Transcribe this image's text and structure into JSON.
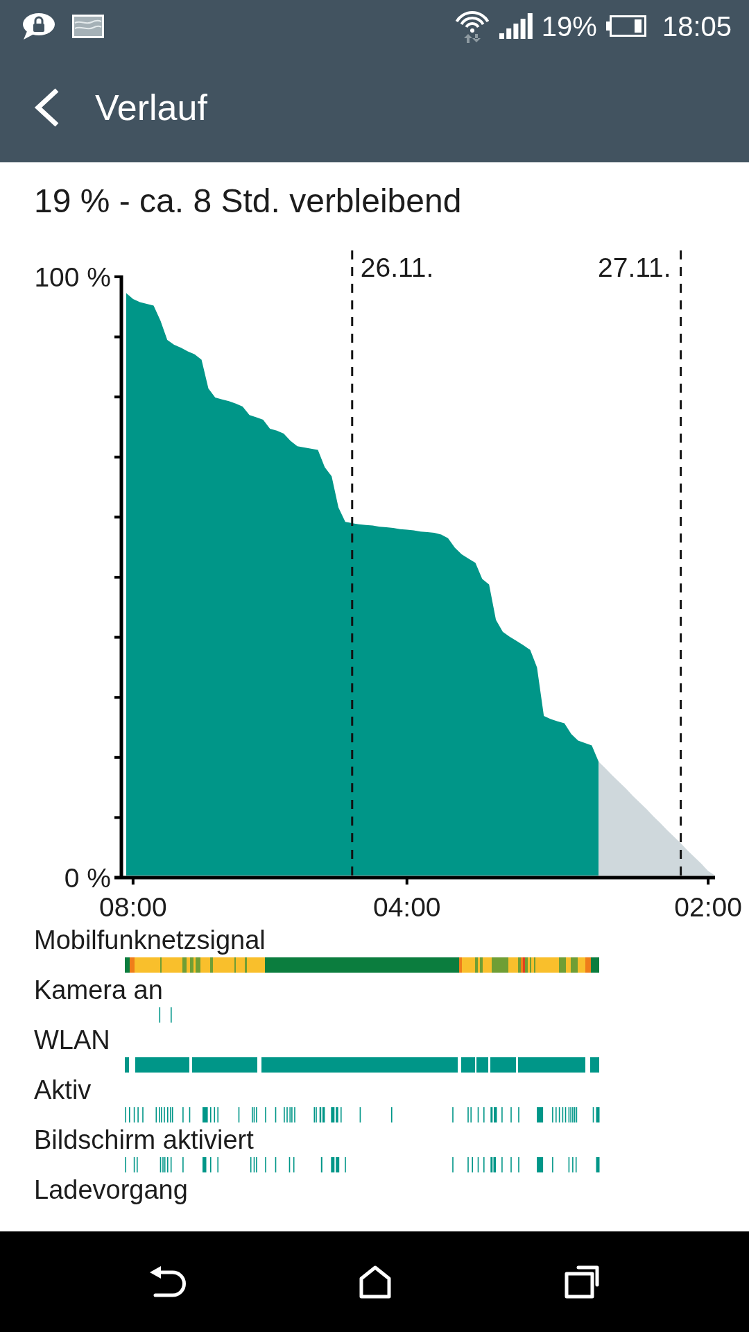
{
  "status_bar": {
    "battery": "19%",
    "time": "18:05"
  },
  "app_bar": {
    "title": "Verlauf"
  },
  "summary": "19 % - ca. 8 Std. verbleibend",
  "chart": {
    "chart_data": {
      "type": "area",
      "categories": [
        null,
        "08:00",
        null,
        null,
        null,
        null,
        null,
        null,
        null,
        null,
        null,
        null,
        null,
        null,
        null,
        null,
        null,
        null,
        null,
        null,
        null,
        null,
        null,
        null,
        null,
        null,
        null,
        null,
        null,
        null,
        null,
        null,
        null,
        null,
        null,
        null,
        null,
        null,
        null,
        null,
        null,
        "04:00",
        null,
        null,
        null,
        null,
        null,
        null,
        null,
        null,
        null,
        null,
        null,
        null,
        null,
        null,
        null,
        null,
        null,
        null,
        null,
        null,
        null,
        null,
        null,
        null,
        null,
        null,
        null,
        null,
        null,
        null,
        null,
        null,
        null,
        null,
        null,
        null,
        null,
        null,
        null,
        null,
        null,
        null,
        null,
        "02:00",
        null
      ],
      "series": [
        {
          "color": "#009688",
          "values": [
            97.3,
            96.3,
            95.8,
            95.5,
            95.2,
            92.7,
            89.5,
            88.7,
            88.2,
            87.6,
            87.1,
            86.2,
            81.4,
            79.9,
            79.6,
            79.3,
            78.9,
            78.4,
            77.0,
            76.6,
            76.2,
            74.7,
            74.4,
            73.9,
            72.7,
            71.8,
            71.6,
            71.4,
            71.2,
            68.3,
            66.8,
            61.6,
            59.2,
            59.0,
            58.8,
            58.7,
            58.6,
            58.4,
            58.3,
            58.2,
            58.0,
            57.9,
            57.8,
            57.6,
            57.5,
            57.4,
            57.1,
            56.5,
            54.9,
            53.8,
            53.1,
            52.4,
            49.7,
            48.8,
            42.9,
            40.9,
            40.1,
            39.4,
            38.7,
            37.9,
            35.0,
            26.9,
            26.4,
            26.0,
            25.7,
            23.9,
            22.8,
            22.4,
            22.0,
            19.3,
            null,
            null,
            null,
            null,
            null,
            null,
            null,
            null,
            null,
            null,
            null,
            null,
            null,
            null,
            null,
            null,
            null
          ]
        },
        {
          "color": "#cfd8dc",
          "values": [
            null,
            null,
            null,
            null,
            null,
            null,
            null,
            null,
            null,
            null,
            null,
            null,
            null,
            null,
            null,
            null,
            null,
            null,
            null,
            null,
            null,
            null,
            null,
            null,
            null,
            null,
            null,
            null,
            null,
            null,
            null,
            null,
            null,
            null,
            null,
            null,
            null,
            null,
            null,
            null,
            null,
            null,
            null,
            null,
            null,
            null,
            null,
            null,
            null,
            null,
            null,
            null,
            null,
            null,
            null,
            null,
            null,
            null,
            null,
            null,
            null,
            null,
            null,
            null,
            null,
            null,
            null,
            null,
            null,
            19.3,
            18.2,
            17.0,
            15.9,
            14.8,
            13.6,
            12.5,
            11.4,
            10.2,
            9.1,
            7.9,
            6.8,
            5.7,
            4.5,
            3.4,
            2.3,
            1.1,
            0
          ]
        }
      ],
      "ylim": [
        0,
        100
      ],
      "yticks": [
        {
          "value": 0,
          "label": "0 %"
        },
        {
          "value": 100,
          "label": "100 %"
        }
      ],
      "annotations": [
        "26.11.",
        "27.11."
      ]
    }
  },
  "timelines": [
    {
      "label": "Mobilfunknetzsignal",
      "kind": "signal"
    },
    {
      "label": "Kamera an",
      "kind": "camera"
    },
    {
      "label": "WLAN",
      "kind": "wlan"
    },
    {
      "label": "Aktiv",
      "kind": "activity"
    },
    {
      "label": "Bildschirm aktiviert",
      "kind": "screen"
    },
    {
      "label": "Ladevorgang",
      "kind": "charging"
    }
  ]
}
